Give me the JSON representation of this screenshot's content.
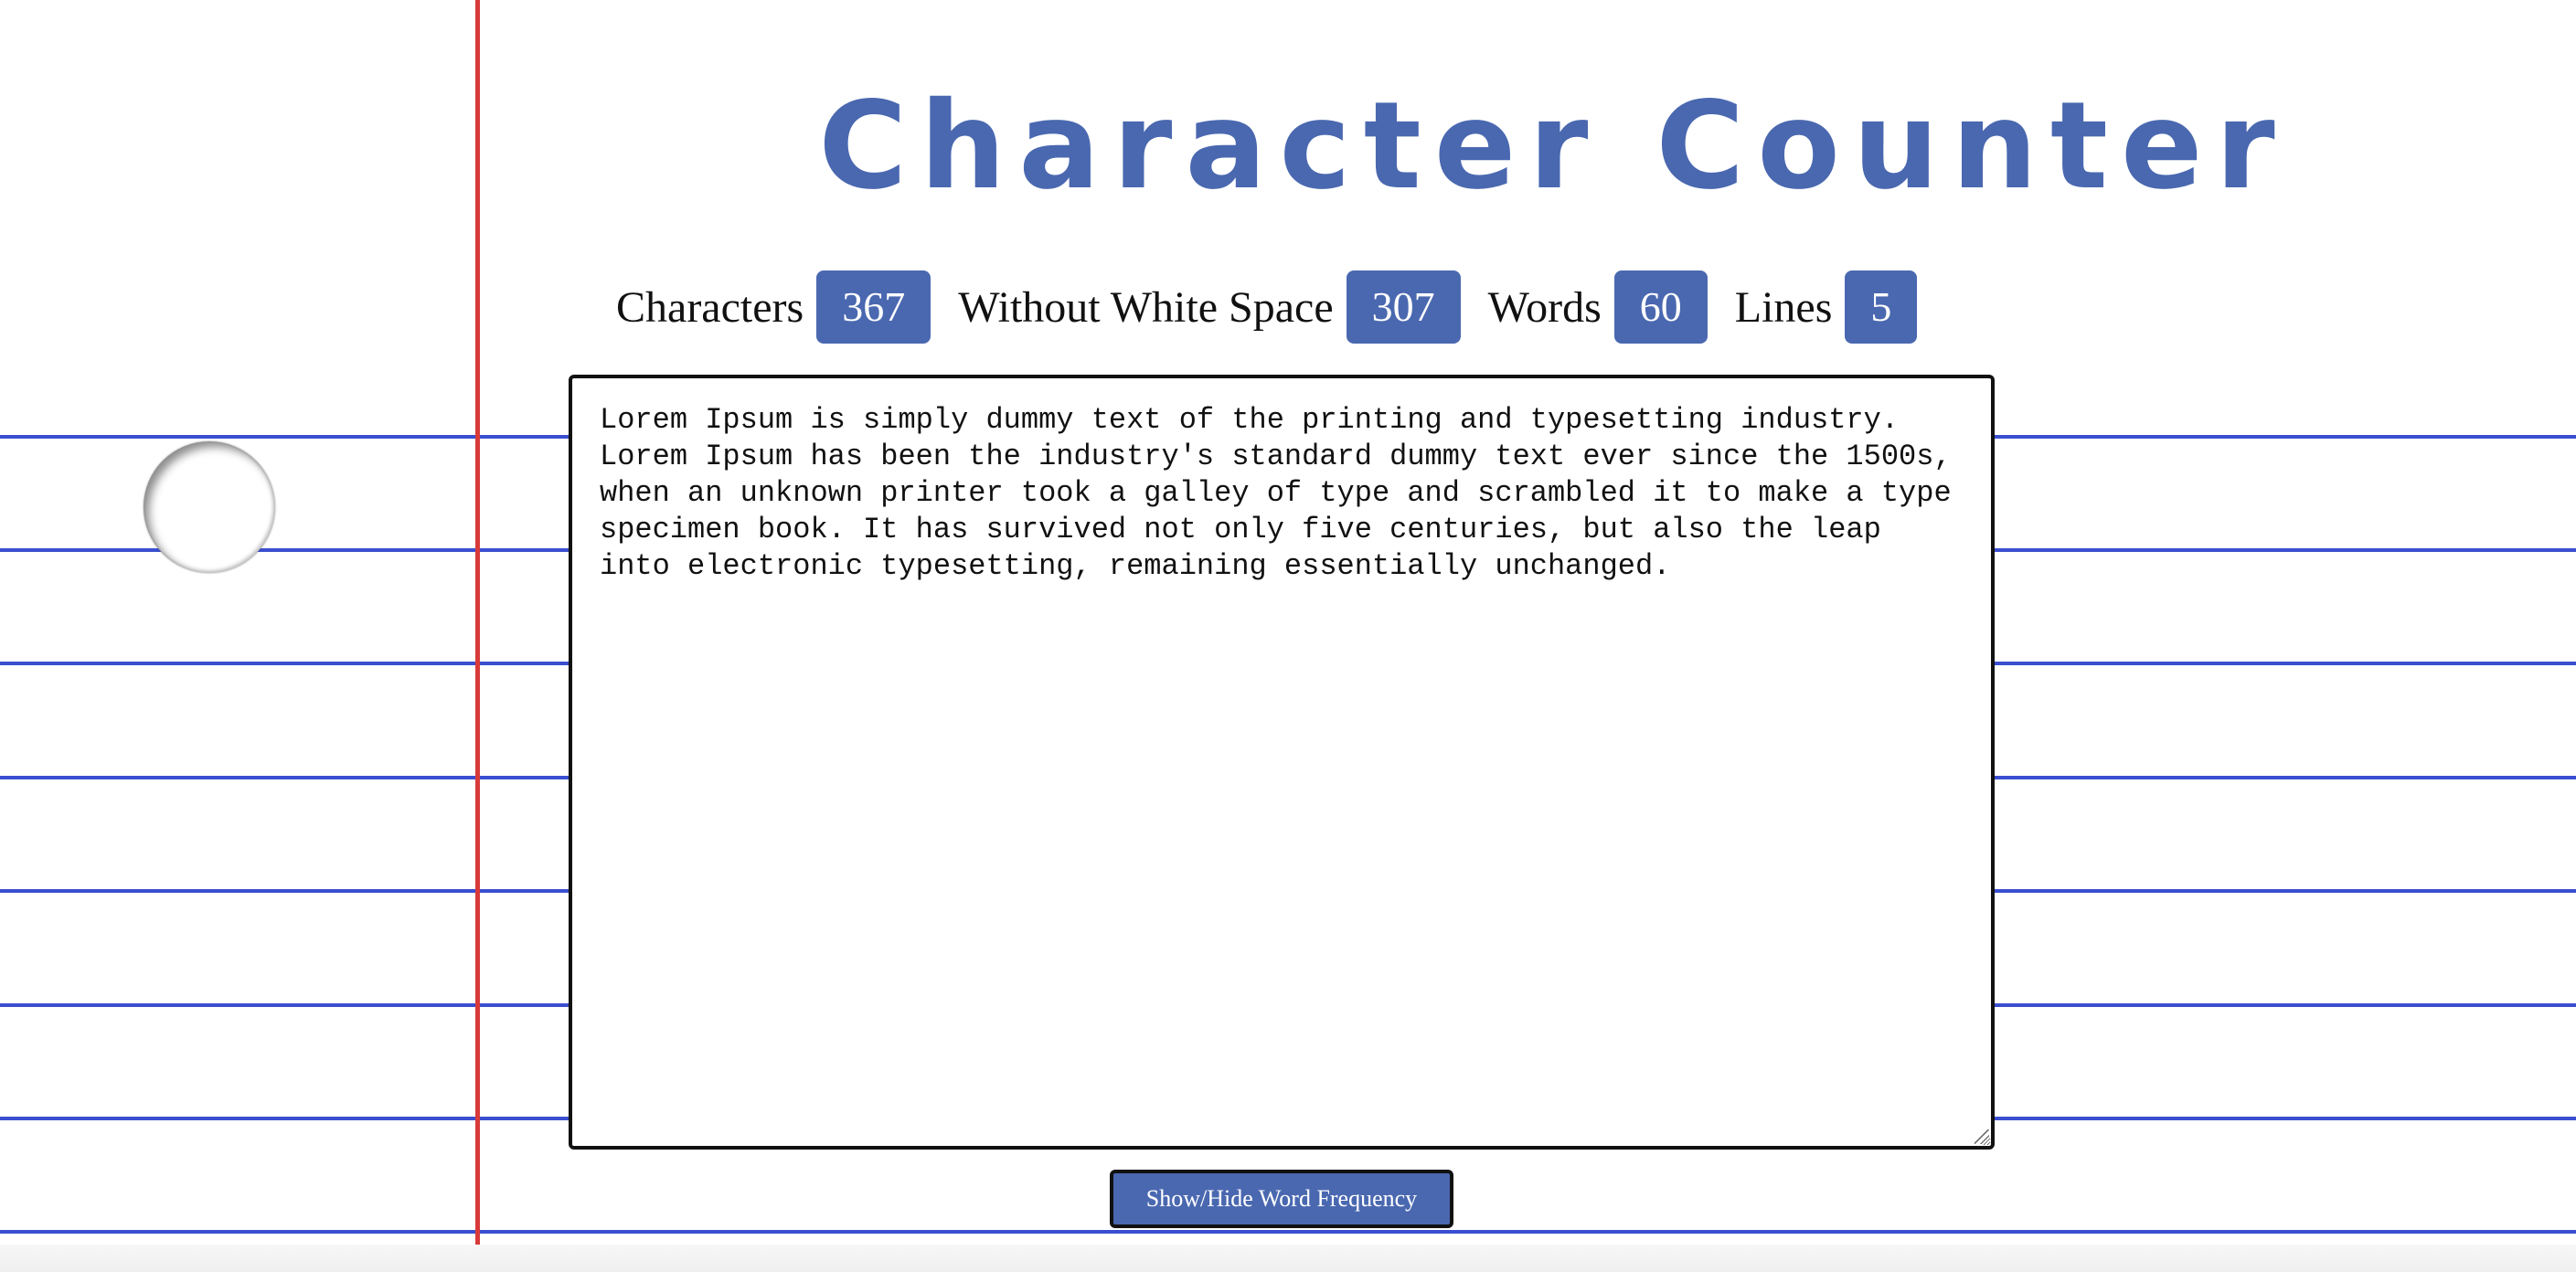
{
  "app": {
    "title": "Character Counter"
  },
  "stats": {
    "characters_label": "Characters",
    "characters_value": "367",
    "no_whitespace_label": "Without White Space",
    "no_whitespace_value": "307",
    "words_label": "Words",
    "words_value": "60",
    "lines_label": "Lines",
    "lines_value": "5"
  },
  "editor": {
    "text": "Lorem Ipsum is simply dummy text of the printing and typesetting industry. Lorem Ipsum has been the industry's standard dummy text ever since the 1500s, when an unknown printer took a galley of type and scrambled it to make a type specimen book. It has survived not only five centuries, but also the leap into electronic typesetting, remaining essentially unchanged."
  },
  "actions": {
    "word_frequency_button": "Show/Hide Word Frequency"
  },
  "colors": {
    "accent": "#4a68b0",
    "rule_line": "#3a4fd0",
    "margin_line": "#d83a3a"
  }
}
